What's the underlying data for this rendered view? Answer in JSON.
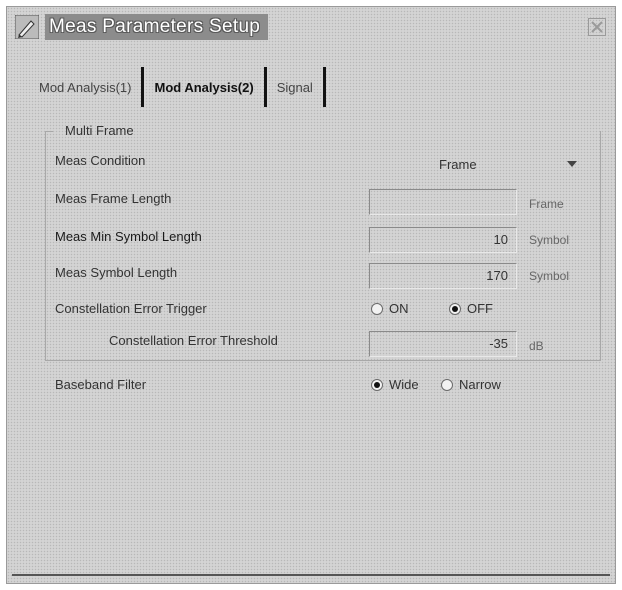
{
  "window": {
    "title": "Meas Parameters Setup",
    "close_icon": "close-icon",
    "app_icon": "pencil-icon"
  },
  "tabs": [
    {
      "label": "Mod Analysis(1)",
      "active": false
    },
    {
      "label": "Mod Analysis(2)",
      "active": true
    },
    {
      "label": "Signal",
      "active": false
    }
  ],
  "multi_frame": {
    "group_title": "Multi Frame",
    "meas_condition": {
      "label": "Meas Condition",
      "value": "Frame"
    },
    "meas_frame_length": {
      "label": "Meas Frame Length",
      "value": "",
      "unit": "Frame"
    },
    "meas_min_symbol_length": {
      "label": "Meas Min Symbol Length",
      "value": "10",
      "unit": "Symbol"
    },
    "meas_symbol_length": {
      "label": "Meas Symbol Length",
      "value": "170",
      "unit": "Symbol"
    },
    "constellation_error_trigger": {
      "label": "Constellation Error Trigger",
      "options": [
        "ON",
        "OFF"
      ],
      "selected": "OFF"
    },
    "constellation_error_threshold": {
      "label": "Constellation Error Threshold",
      "value": "-35",
      "unit": "dB"
    }
  },
  "baseband_filter": {
    "label": "Baseband Filter",
    "options": [
      "Wide",
      "Narrow"
    ],
    "selected": "Wide"
  }
}
